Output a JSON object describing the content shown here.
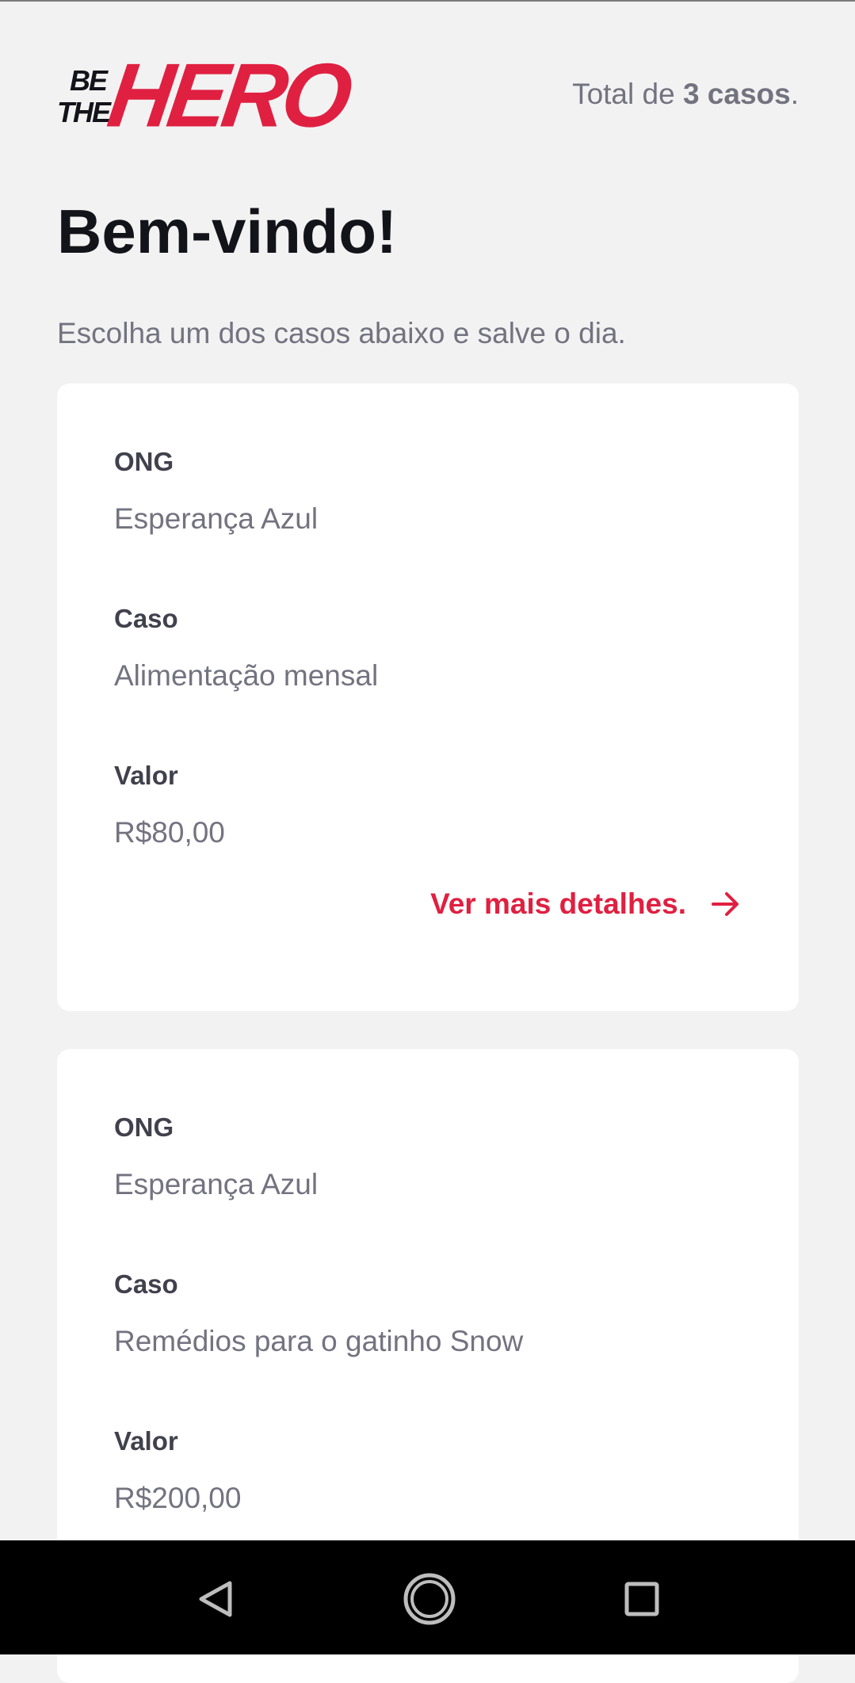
{
  "brand": {
    "logo_be": "BE",
    "logo_the": "THE",
    "logo_hero": "HERO",
    "accent_color": "#e02041"
  },
  "header": {
    "total_prefix": "Total de ",
    "total_count": "3 casos",
    "total_suffix": "."
  },
  "page": {
    "title": "Bem-vindo!",
    "subtitle": "Escolha um dos casos abaixo e salve o dia."
  },
  "labels": {
    "ong": "ONG",
    "caso": "Caso",
    "valor": "Valor",
    "details": "Ver mais detalhes."
  },
  "incidents": [
    {
      "ong": "Esperança Azul",
      "caso": "Alimentação mensal",
      "valor": "R$80,00"
    },
    {
      "ong": "Esperança Azul",
      "caso": "Remédios para o gatinho Snow",
      "valor": "R$200,00"
    }
  ],
  "icons": {
    "details_arrow": "arrow-right-icon",
    "nav_back": "back-triangle-icon",
    "nav_home": "home-circle-icon",
    "nav_recents": "recents-square-icon"
  }
}
